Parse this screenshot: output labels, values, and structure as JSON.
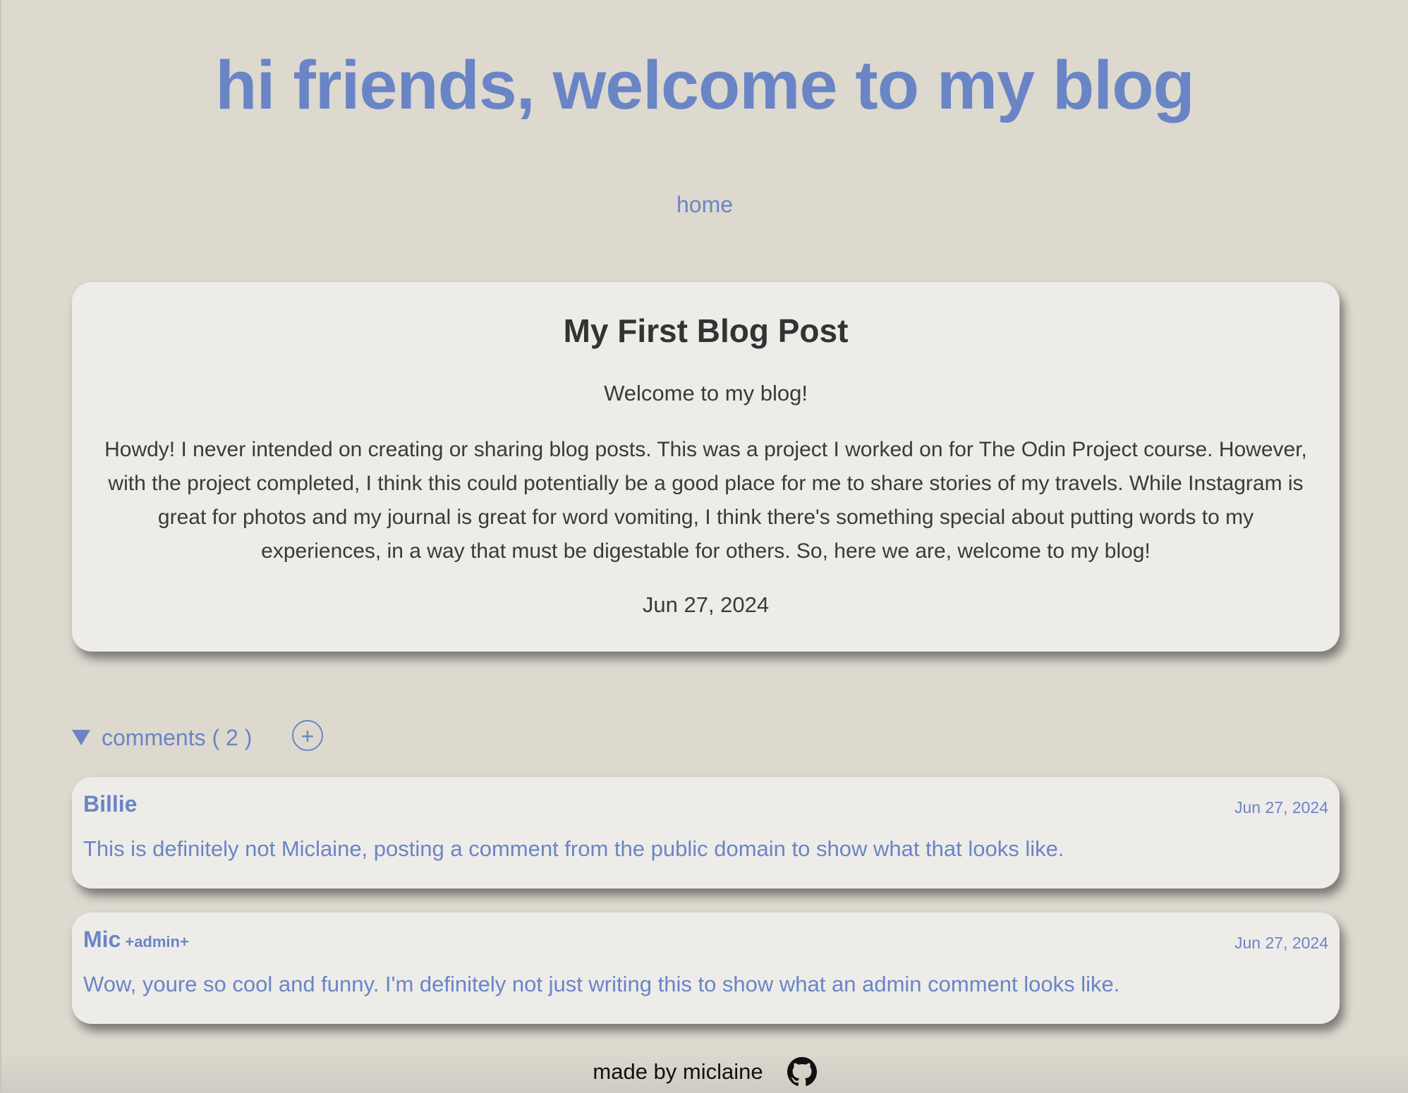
{
  "header": {
    "title": "hi friends, welcome to my blog"
  },
  "nav": {
    "home_label": "home"
  },
  "post": {
    "title": "My First Blog Post",
    "subtitle": "Welcome to my blog!",
    "body": "Howdy! I never intended on creating or sharing blog posts. This was a project I worked on for The Odin Project course. However, with the project completed, I think this could potentially be a good place for me to share stories of my travels. While Instagram is great for photos and my journal is great for word vomiting, I think there's something special about putting words to my experiences, in a way that must be digestable for others. So, here we are, welcome to my blog!",
    "date": "Jun 27, 2024"
  },
  "comments": {
    "label": "comments ( 2 )",
    "add_icon": "plus-circle-icon",
    "add_symbol": "+",
    "items": [
      {
        "author": "Billie",
        "badge": "",
        "date": "Jun 27, 2024",
        "text": "This is definitely not Miclaine, posting a comment from the public domain to show what that looks like."
      },
      {
        "author": "Mic",
        "badge": "+admin+",
        "date": "Jun 27, 2024",
        "text": "Wow, youre so cool and funny. I'm definitely not just writing this to show what an admin comment looks like."
      }
    ]
  },
  "footer": {
    "text": "made by miclaine",
    "icon": "github-icon"
  },
  "colors": {
    "accent": "#6a85c6",
    "background": "#ddd9cf",
    "card": "#eeece8",
    "text": "#3a3a3a"
  }
}
